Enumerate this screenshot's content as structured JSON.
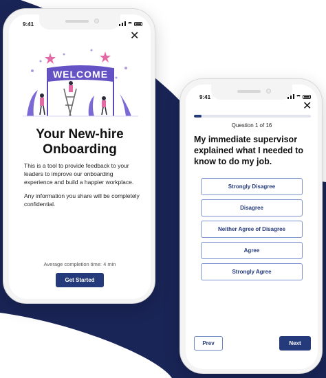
{
  "background": {
    "navy": "#1a2557",
    "accent": "#253a7a"
  },
  "welcome_screen": {
    "status_time": "9:41",
    "banner_text": "WELCOME",
    "title_line1": "Your New-hire",
    "title_line2": "Onboarding",
    "paragraph1": "This is a tool to provide feedback to your leaders to improve our onboarding experience and build a happier workplace.",
    "paragraph2": "Any information you share will be completely confidential.",
    "completion_time": "Average completion time: 4 min",
    "get_started_label": "Get Started"
  },
  "question_screen": {
    "status_time": "9:41",
    "progress_label": "Question 1 of 16",
    "progress_value": 0.0625,
    "question": "My immediate supervisor explained what I needed to know to do my job.",
    "options": [
      "Strongly Disagree",
      "Disagree",
      "Neither Agree of Disagree",
      "Agree",
      "Strongly Agree"
    ],
    "prev_label": "Prev",
    "next_label": "Next"
  }
}
